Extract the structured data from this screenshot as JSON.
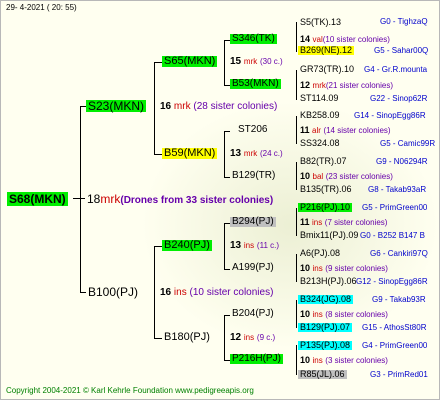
{
  "header": {
    "date_line": "29-  4-2021  ( 20: 55)"
  },
  "footer": {
    "copyright": "Copyright 2004-2021 © Karl Kehrle Foundation    www.pedigreeapis.org"
  },
  "root": {
    "name": "S68(MKN)",
    "gen": "18",
    "code": "mrk",
    "note": "(Drones from 33 sister colonies)"
  },
  "g1": [
    {
      "name": "S23(MKN)",
      "gen": "16",
      "code": "mrk",
      "note": "(28 sister colonies)"
    },
    {
      "name": "B100(PJ)",
      "gen": "16",
      "code": "ins",
      "note": "(10 sister colonies)"
    }
  ],
  "g2": [
    {
      "name": "S65(MKN)",
      "gen": "15",
      "code": "mrk",
      "note": "(30 c.)"
    },
    {
      "name": "B59(MKN)",
      "gen": "13",
      "code": "mrk",
      "note": "(24 c.)"
    },
    {
      "name": "B240(PJ)",
      "gen": "13",
      "code": "ins",
      "note": "(11 c.)"
    },
    {
      "name": "B180(PJ)",
      "gen": "12",
      "code": "ins",
      "note": "(9 c.)"
    }
  ],
  "g3": [
    {
      "name": "S346(TK)",
      "gen": "14",
      "code": "val",
      "note": "(10 sister colonies)"
    },
    {
      "name": "B53(MKN)",
      "gen": "12",
      "code": "mrk",
      "note": "(21 sister colonies)"
    },
    {
      "name": "ST206",
      "gen": "11",
      "code": "alr",
      "note": "(14 sister colonies)"
    },
    {
      "name": "B129(TR)",
      "gen": "10",
      "code": "bal",
      "note": "(23 sister colonies)"
    },
    {
      "name": "B294(PJ)",
      "gen": "11",
      "code": "ins",
      "note": "(7 sister colonies)"
    },
    {
      "name": "A199(PJ)",
      "gen": "10",
      "code": "ins",
      "note": "(9 sister colonies)"
    },
    {
      "name": "B204(PJ)",
      "gen": "10",
      "code": "ins",
      "note": "(8 sister colonies)"
    },
    {
      "name": "P216H(PJ)",
      "gen": "10",
      "code": "ins",
      "note": "(3 sister colonies)"
    }
  ],
  "g4": [
    {
      "name": "S5(TK).13",
      "right": "G0 - TighzaQ"
    },
    {
      "name": "B269(NE).12",
      "right": "G5 - Sahar00Q"
    },
    {
      "name": "GR73(TR).10",
      "right": "G4 - Gr.R.mounta"
    },
    {
      "name": "ST114.09",
      "right": "G22 - Sinop62R"
    },
    {
      "name": "KB258.09",
      "right": "G14 - SinopEgg86R"
    },
    {
      "name": "SS324.08",
      "right": "G5 - Camic99R"
    },
    {
      "name": "B82(TR).07",
      "right": "G9 - N06294R"
    },
    {
      "name": "B135(TR).06",
      "right": "G8 - Takab93aR"
    },
    {
      "name": "P216(PJ).10",
      "right": "G5 - PrimGreen00"
    },
    {
      "name": "Bmix11(PJ).09",
      "right": "G0 - B252 B147 B"
    },
    {
      "name": "A6(PJ).08",
      "right": "G6 - Cankiri97Q"
    },
    {
      "name": "B213H(PJ).06",
      "right": "G12 - SinopEgg86R"
    },
    {
      "name": "B324(JG).08",
      "right": "G9 - Takab93R"
    },
    {
      "name": "B129(PJ).07",
      "right": "G15 - AthosSt80R"
    },
    {
      "name": "P135(PJ).08",
      "right": "G4 - PrimGreen00"
    },
    {
      "name": "R85(JL).06",
      "right": "G3 - PrimRed01"
    }
  ]
}
